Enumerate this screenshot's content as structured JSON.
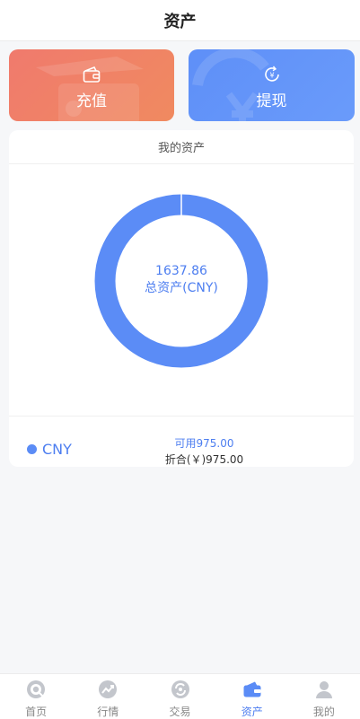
{
  "header": {
    "title": "资产"
  },
  "actions": {
    "recharge_label": "充值",
    "withdraw_label": "提现"
  },
  "assets_card": {
    "title": "我的资产",
    "total_value": "1637.86",
    "total_label": "总资产(CNY)",
    "donut_color": "#5b8cf6",
    "items": [
      {
        "currency": "CNY",
        "available": "可用975.00",
        "equivalent": "折合(￥)975.00"
      }
    ]
  },
  "tabbar": {
    "active_index": 3,
    "items": [
      {
        "label": "首页",
        "icon": "home-icon"
      },
      {
        "label": "行情",
        "icon": "market-icon"
      },
      {
        "label": "交易",
        "icon": "trade-icon"
      },
      {
        "label": "资产",
        "icon": "wallet-icon"
      },
      {
        "label": "我的",
        "icon": "profile-icon"
      }
    ]
  },
  "colors": {
    "accent": "#4d7ef0",
    "recharge_gradient": [
      "#f07a6d",
      "#f08a60"
    ],
    "withdraw_gradient": [
      "#5e8ff8",
      "#6a9bfa"
    ],
    "tab_inactive": "#c3c6cc"
  }
}
